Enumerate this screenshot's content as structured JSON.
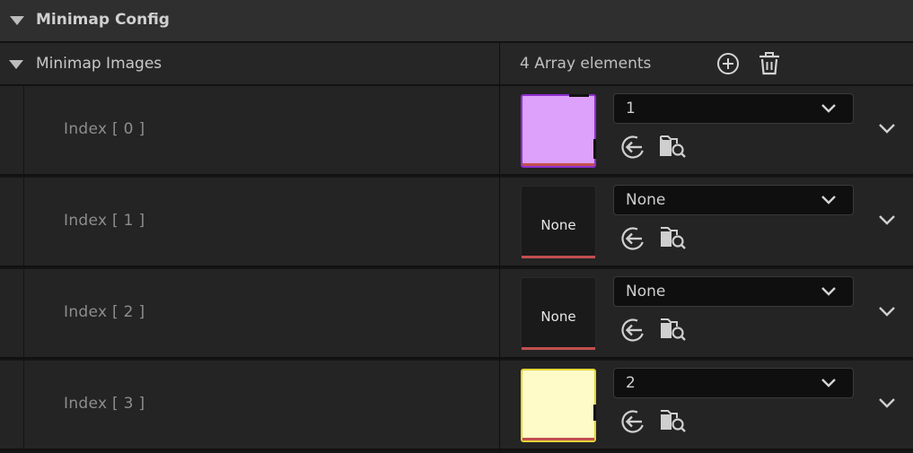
{
  "category": {
    "title": "Minimap Config"
  },
  "array": {
    "name": "Minimap Images",
    "count_label": "4 Array elements",
    "add_icon": "plus-circle-icon",
    "delete_icon": "trash-icon"
  },
  "rows": [
    {
      "label": "Index [ 0 ]",
      "dropdown_value": "1",
      "thumb_text": "",
      "thumb_color": "#dda0fb",
      "thumb_border": "#8e2fd1"
    },
    {
      "label": "Index [ 1 ]",
      "dropdown_value": "None",
      "thumb_text": "None",
      "thumb_color": "#1a1a1a",
      "thumb_border": "#2a2a2a"
    },
    {
      "label": "Index [ 2 ]",
      "dropdown_value": "None",
      "thumb_text": "None",
      "thumb_color": "#1a1a1a",
      "thumb_border": "#2a2a2a"
    },
    {
      "label": "Index [ 3 ]",
      "dropdown_value": "2",
      "thumb_text": "",
      "thumb_color": "#fffbc8",
      "thumb_border": "#e3d43a"
    }
  ],
  "colors": {
    "missing_asset_bar": "#c24f4f",
    "panel": "#242424"
  }
}
